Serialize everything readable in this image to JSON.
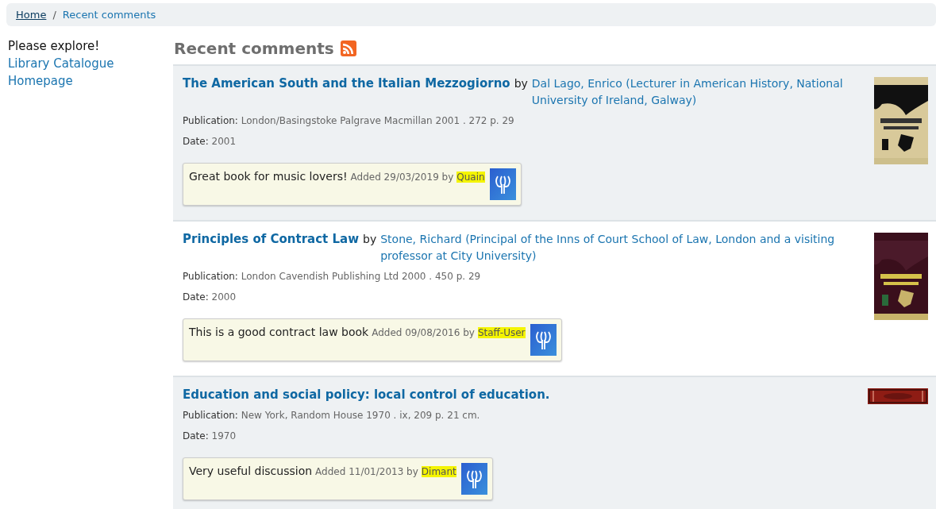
{
  "breadcrumb": [
    {
      "label": "Home",
      "link": true
    },
    {
      "separator": "/",
      "label": "Recent comments",
      "link": false
    }
  ],
  "sidebar": {
    "intro": "Please explore!",
    "links": [
      "Library Catalogue",
      "Homepage"
    ]
  },
  "heading": "Recent comments",
  "comments": [
    {
      "title": "The American South and the Italian Mezzogiorno",
      "by": "by",
      "author": "Dal Lago, Enrico (Lecturer in American History, National University of Ireland, Galway)",
      "publication_label": "Publication:",
      "publication": "London/Basingstoke Palgrave Macmillan 2001 . 272 p. 29",
      "date_label": "Date:",
      "date": "2001",
      "comment": "Great book for music lovers!",
      "added": "Added 29/03/2019 by",
      "user": "Quain",
      "highlighted": true
    },
    {
      "title": "Principles of Contract Law",
      "by": "by",
      "author": "Stone, Richard (Principal of the Inns of Court School of Law, London and a visiting professor at City University)",
      "publication_label": "Publication:",
      "publication": "London Cavendish Publishing Ltd 2000 . 450 p. 29",
      "date_label": "Date:",
      "date": "2000",
      "comment": "This is a good contract law book",
      "added": "Added 09/08/2016 by",
      "user": "Staff-User",
      "highlighted": true
    },
    {
      "title": "Education and social policy: local control of education.",
      "publication_label": "Publication:",
      "publication": "New York, Random House 1970 . ix, 209 p. 21 cm.",
      "date_label": "Date:",
      "date": "1970",
      "comment": "Very useful discussion",
      "added": "Added 11/01/2013 by",
      "user": "Dimant",
      "highlighted": true
    }
  ]
}
